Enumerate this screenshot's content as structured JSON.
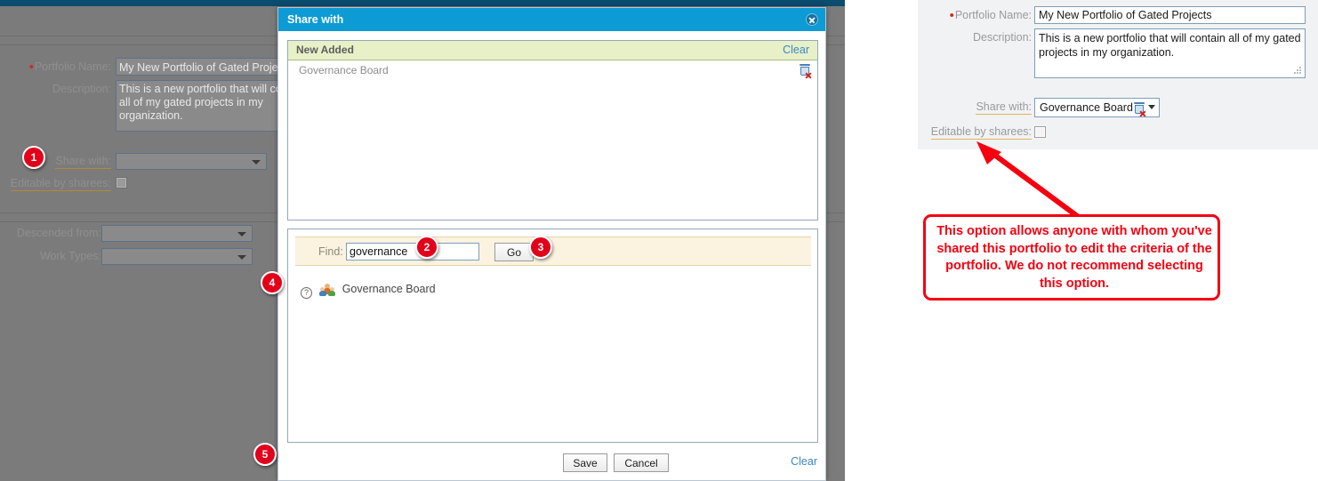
{
  "background_form": {
    "fields": [
      {
        "label": "Portfolio Name:",
        "required": true,
        "value": "My New Portfolio of Gated Projects"
      },
      {
        "label": "Description:",
        "required": false,
        "value": "This is a new portfolio that will contain all of my gated projects in my organization."
      },
      {
        "label": "Share with:",
        "required": false,
        "value": ""
      },
      {
        "label": "Editable by sharees:",
        "required": false,
        "value": ""
      },
      {
        "label": "Descended from:",
        "required": false,
        "value": ""
      },
      {
        "label": "Work Types:",
        "required": false,
        "value": ""
      }
    ]
  },
  "modal": {
    "title": "Share with",
    "close_label": "close",
    "new_added": {
      "header": "New Added",
      "clear_label": "Clear",
      "items": [
        {
          "name": "Governance Board",
          "delete_label": "delete"
        }
      ]
    },
    "search": {
      "find_label": "Find:",
      "find_value": "governance",
      "find_placeholder": "",
      "go_label": "Go",
      "results": [
        {
          "name": "Governance Board",
          "help_label": "?"
        }
      ]
    },
    "footer": {
      "save_label": "Save",
      "cancel_label": "Cancel",
      "clear_label": "Clear"
    }
  },
  "badges": [
    {
      "number": "1"
    },
    {
      "number": "2"
    },
    {
      "number": "3"
    },
    {
      "number": "4"
    },
    {
      "number": "5"
    }
  ],
  "right_panel": {
    "portfolio_name_label": "Portfolio Name:",
    "portfolio_name_value": "My New Portfolio of Gated Projects",
    "description_label": "Description:",
    "description_value": "This is a new portfolio that will contain all of my gated projects in my organization.",
    "share_with_label": "Share with:",
    "share_with_value": "Governance Board",
    "editable_label": "Editable by sharees:"
  },
  "callout": {
    "text": "This option allows anyone with whom you've shared this portfolio to edit the criteria of the portfolio. We do not recommend selecting this option."
  },
  "colors": {
    "title_bar": "#0c9bd4",
    "badge_red": "#e2001a",
    "callout_red": "#f5000f",
    "new_added_green": "#e7f0c7",
    "find_bar_cream": "#fbf3e0",
    "link_blue": "#3b87c8"
  }
}
